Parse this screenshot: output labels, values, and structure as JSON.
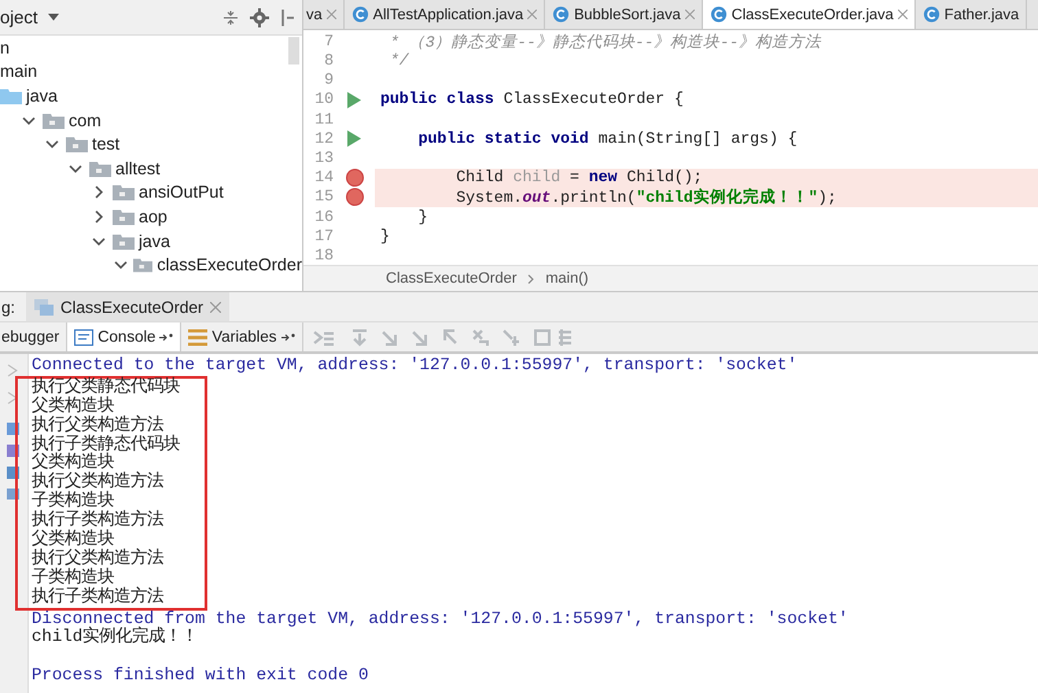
{
  "project_panel": {
    "title": "oject",
    "tree": [
      {
        "label": "n",
        "kind": "text"
      },
      {
        "label": "main",
        "kind": "text",
        "children": [
          {
            "label": "java",
            "kind": "source",
            "children": [
              {
                "label": "com",
                "kind": "folder",
                "expanded": true,
                "children": [
                  {
                    "label": "test",
                    "kind": "folder",
                    "expanded": true,
                    "children": [
                      {
                        "label": "alltest",
                        "kind": "folder",
                        "expanded": true,
                        "children": [
                          {
                            "label": "ansiOutPut",
                            "kind": "folder",
                            "expanded": false
                          },
                          {
                            "label": "aop",
                            "kind": "folder",
                            "expanded": false
                          },
                          {
                            "label": "java",
                            "kind": "folder",
                            "expanded": true,
                            "children": [
                              {
                                "label": "classExecuteOrder",
                                "kind": "folder",
                                "expanded": true
                              }
                            ]
                          }
                        ]
                      }
                    ]
                  }
                ]
              }
            ]
          }
        ]
      }
    ]
  },
  "editor": {
    "tabs": [
      {
        "label": "va",
        "selected": false
      },
      {
        "label": "AllTestApplication.java",
        "selected": false
      },
      {
        "label": "BubbleSort.java",
        "selected": false
      },
      {
        "label": "ClassExecuteOrder.java",
        "selected": true
      },
      {
        "label": "Father.java",
        "selected": false
      }
    ],
    "lines": [
      {
        "number": "7",
        "runnable": false,
        "breakpoint": false,
        "highlighted": false,
        "tokens": [
          {
            "kind": "comment",
            "text": " * （3）静态变量--》静态代码块--》构造块--》构造方法"
          }
        ]
      },
      {
        "number": "8",
        "runnable": false,
        "breakpoint": false,
        "highlighted": false,
        "tokens": [
          {
            "kind": "comment",
            "text": " */"
          }
        ]
      },
      {
        "number": "9",
        "runnable": false,
        "breakpoint": false,
        "highlighted": false
      },
      {
        "number": "10",
        "runnable": true,
        "breakpoint": false,
        "highlighted": false,
        "tokens": [
          {
            "kind": "keyword",
            "text": "public class"
          },
          {
            "kind": "plain",
            "text": " ClassExecuteOrder {"
          }
        ]
      },
      {
        "number": "11",
        "runnable": false,
        "breakpoint": false,
        "highlighted": false
      },
      {
        "number": "12",
        "runnable": true,
        "breakpoint": false,
        "highlighted": false,
        "tokens": [
          {
            "kind": "indent"
          },
          {
            "kind": "keyword",
            "text": "public static void"
          },
          {
            "kind": "plain",
            "text": " main(String[] args) {"
          }
        ]
      },
      {
        "number": "13",
        "runnable": false,
        "breakpoint": false,
        "highlighted": false
      },
      {
        "number": "14",
        "runnable": false,
        "breakpoint": true,
        "highlighted": true,
        "tokens": [
          {
            "kind": "indent"
          },
          {
            "kind": "indent"
          },
          {
            "kind": "plain",
            "text": "Child "
          },
          {
            "kind": "unused",
            "text": "child"
          },
          {
            "kind": "plain",
            "text": " = "
          },
          {
            "kind": "keyword",
            "text": "new"
          },
          {
            "kind": "plain",
            "text": " Child();"
          }
        ]
      },
      {
        "number": "15",
        "runnable": false,
        "breakpoint": true,
        "highlighted": true,
        "tokens": [
          {
            "kind": "indent"
          },
          {
            "kind": "indent"
          },
          {
            "kind": "plain",
            "text": "System."
          },
          {
            "kind": "field",
            "text": "out"
          },
          {
            "kind": "plain",
            "text": ".println("
          },
          {
            "kind": "string",
            "text": "\"child实例化完成！！\""
          },
          {
            "kind": "plain",
            "text": ");"
          }
        ]
      },
      {
        "number": "16",
        "runnable": false,
        "breakpoint": false,
        "highlighted": false,
        "tokens": [
          {
            "kind": "indent"
          },
          {
            "kind": "plain",
            "text": "}"
          }
        ]
      },
      {
        "number": "17",
        "runnable": false,
        "breakpoint": false,
        "highlighted": false,
        "tokens": [
          {
            "kind": "plain",
            "text": "}"
          }
        ]
      },
      {
        "number": "18",
        "runnable": false,
        "breakpoint": false,
        "highlighted": false
      }
    ],
    "breadcrumbs": [
      "ClassExecuteOrder",
      "main()"
    ]
  },
  "debug": {
    "title": "g:",
    "session": "ClassExecuteOrder",
    "tabs": [
      {
        "label": "ebugger",
        "selected": false
      },
      {
        "label": "Console",
        "selected": true
      },
      {
        "label": "Variables",
        "selected": false
      }
    ],
    "console": [
      {
        "kind": "system",
        "text": "Connected to the target VM, address: '127.0.0.1:55997', transport: 'socket'"
      },
      {
        "kind": "output",
        "text": "执行父类静态代码块"
      },
      {
        "kind": "output",
        "text": "父类构造块"
      },
      {
        "kind": "output",
        "text": "执行父类构造方法"
      },
      {
        "kind": "output",
        "text": "执行子类静态代码块"
      },
      {
        "kind": "output",
        "text": "父类构造块"
      },
      {
        "kind": "output",
        "text": "执行父类构造方法"
      },
      {
        "kind": "output",
        "text": "子类构造块"
      },
      {
        "kind": "output",
        "text": "执行子类构造方法"
      },
      {
        "kind": "output",
        "text": "父类构造块"
      },
      {
        "kind": "output",
        "text": "执行父类构造方法"
      },
      {
        "kind": "output",
        "text": "子类构造块"
      },
      {
        "kind": "output",
        "text": "执行子类构造方法"
      },
      {
        "kind": "system",
        "text": "Disconnected from the target VM, address: '127.0.0.1:55997', transport: 'socket'"
      },
      {
        "kind": "output",
        "text": "child实例化完成！！"
      },
      {
        "kind": "blank"
      },
      {
        "kind": "system",
        "text": "Process finished with exit code 0"
      }
    ]
  }
}
